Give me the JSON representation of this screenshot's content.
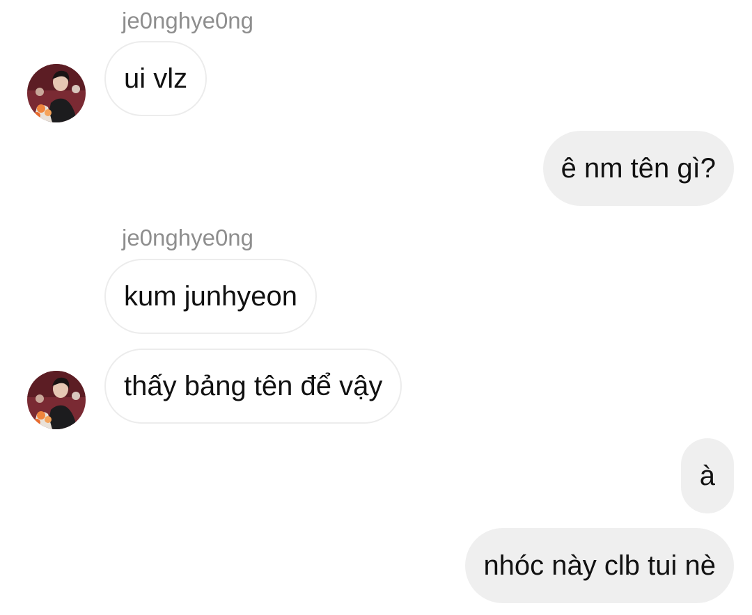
{
  "messages": [
    {
      "direction": "incoming",
      "sender": "je0nghye0ng",
      "text": "ui vlz"
    },
    {
      "direction": "outgoing",
      "text": "ê nm tên gì?"
    },
    {
      "direction": "incoming",
      "sender": "je0nghye0ng",
      "text": "kum junhyeon"
    },
    {
      "direction": "incoming",
      "text": "thấy bảng tên để vậy"
    },
    {
      "direction": "outgoing",
      "text": "à"
    },
    {
      "direction": "outgoing",
      "text": "nhóc này clb tui nè"
    }
  ],
  "colors": {
    "incoming_bubble_bg": "#ffffff",
    "incoming_bubble_border": "#ececec",
    "outgoing_bubble_bg": "#efefef",
    "sender_name": "#8e8e8e",
    "text": "#111111"
  },
  "icons": {
    "avatar": "contact-avatar-photo"
  }
}
